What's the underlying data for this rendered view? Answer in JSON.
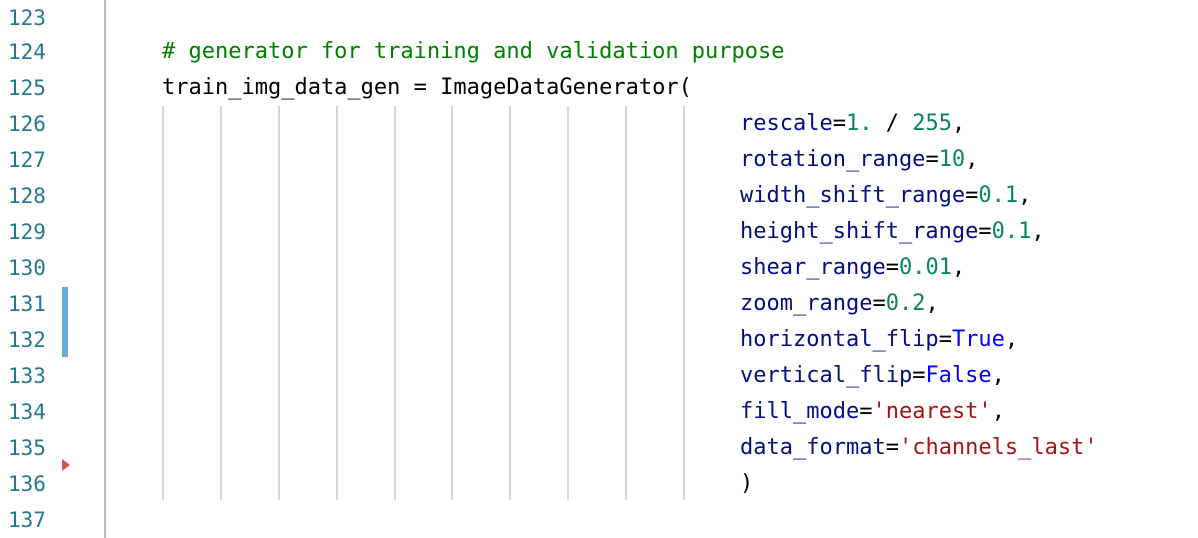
{
  "editor": {
    "line_numbers": [
      "123",
      "124",
      "125",
      "126",
      "127",
      "128",
      "129",
      "130",
      "131",
      "132",
      "133",
      "134",
      "135",
      "136",
      "137"
    ],
    "lines": [
      {
        "tokens": []
      },
      {
        "tokens": [
          {
            "t": "comment",
            "v": "# generator for training and validation purpose"
          }
        ]
      },
      {
        "tokens": [
          {
            "t": "ident",
            "v": "train_img_data_gen"
          },
          {
            "t": "op",
            "v": " = "
          },
          {
            "t": "ident",
            "v": "ImageDataGenerator"
          },
          {
            "t": "op",
            "v": "("
          }
        ]
      },
      {
        "tokens": [
          {
            "t": "param",
            "v": "rescale"
          },
          {
            "t": "op",
            "v": "="
          },
          {
            "t": "num",
            "v": "1."
          },
          {
            "t": "op",
            "v": " / "
          },
          {
            "t": "num",
            "v": "255"
          },
          {
            "t": "op",
            "v": ","
          }
        ]
      },
      {
        "tokens": [
          {
            "t": "param",
            "v": "rotation_range"
          },
          {
            "t": "op",
            "v": "="
          },
          {
            "t": "num",
            "v": "10"
          },
          {
            "t": "op",
            "v": ","
          }
        ]
      },
      {
        "tokens": [
          {
            "t": "param",
            "v": "width_shift_range"
          },
          {
            "t": "op",
            "v": "="
          },
          {
            "t": "num",
            "v": "0.1"
          },
          {
            "t": "op",
            "v": ","
          }
        ]
      },
      {
        "tokens": [
          {
            "t": "param",
            "v": "height_shift_range"
          },
          {
            "t": "op",
            "v": "="
          },
          {
            "t": "num",
            "v": "0.1"
          },
          {
            "t": "op",
            "v": ","
          }
        ]
      },
      {
        "tokens": [
          {
            "t": "param",
            "v": "shear_range"
          },
          {
            "t": "op",
            "v": "="
          },
          {
            "t": "num",
            "v": "0.01"
          },
          {
            "t": "op",
            "v": ","
          }
        ]
      },
      {
        "tokens": [
          {
            "t": "param",
            "v": "zoom_range"
          },
          {
            "t": "op",
            "v": "="
          },
          {
            "t": "num",
            "v": "0.2"
          },
          {
            "t": "op",
            "v": ","
          }
        ]
      },
      {
        "tokens": [
          {
            "t": "param",
            "v": "horizontal_flip"
          },
          {
            "t": "op",
            "v": "="
          },
          {
            "t": "kw",
            "v": "True"
          },
          {
            "t": "op",
            "v": ","
          }
        ]
      },
      {
        "tokens": [
          {
            "t": "param",
            "v": "vertical_flip"
          },
          {
            "t": "op",
            "v": "="
          },
          {
            "t": "kw",
            "v": "False"
          },
          {
            "t": "op",
            "v": ","
          }
        ]
      },
      {
        "tokens": [
          {
            "t": "param",
            "v": "fill_mode"
          },
          {
            "t": "op",
            "v": "="
          },
          {
            "t": "str",
            "v": "'nearest'"
          },
          {
            "t": "op",
            "v": ","
          }
        ]
      },
      {
        "tokens": [
          {
            "t": "param",
            "v": "data_format"
          },
          {
            "t": "op",
            "v": "="
          },
          {
            "t": "str",
            "v": "'channels_last'"
          }
        ]
      },
      {
        "tokens": [
          {
            "t": "op",
            "v": ")"
          }
        ]
      },
      {
        "tokens": []
      }
    ],
    "colors": {
      "line_number": "#237893",
      "comment": "#008000",
      "parameter": "#001080",
      "number": "#098658",
      "keyword": "#0000ff",
      "string": "#a31515",
      "change_marker": "#6fa8d8",
      "fold_marker": "#d9534f",
      "indent_guide": "#d7d7d7"
    },
    "modified_lines": [
      "131",
      "132"
    ],
    "fold_marker_line": "136",
    "icons": [
      "change-marker-icon",
      "fold-arrow-icon"
    ]
  }
}
